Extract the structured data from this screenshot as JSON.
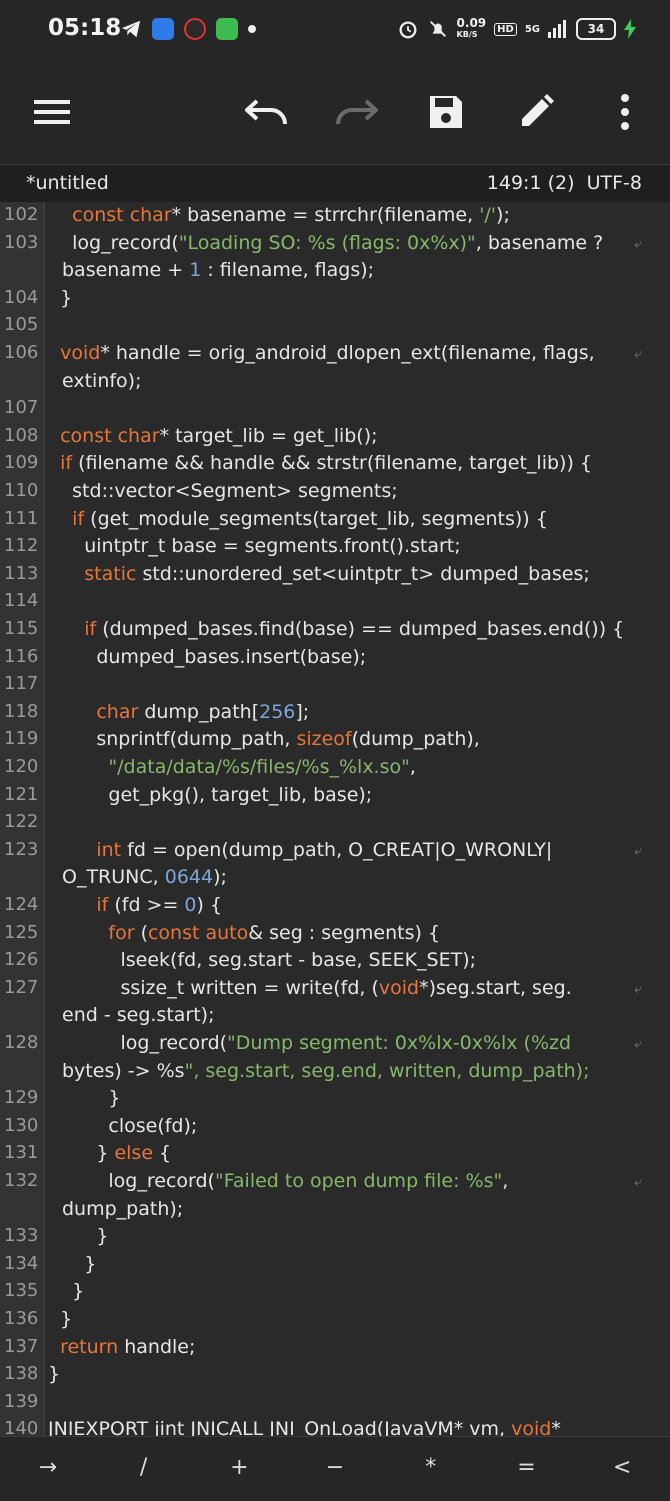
{
  "status_bar": {
    "time": "05:18",
    "net_speed": "0.09",
    "net_unit": "KB/S",
    "signal": "5G",
    "battery": "34"
  },
  "toolbar": {
    "menu_icon": "hamburger-menu-icon",
    "undo_icon": "undo-icon",
    "redo_icon": "redo-icon",
    "save_icon": "save-icon",
    "edit_icon": "pencil-icon",
    "more_icon": "more-vertical-icon"
  },
  "file": {
    "name": "*untitled",
    "position": "149:1 (2)",
    "encoding": "UTF-8"
  },
  "colors": {
    "keyword": "#e6763a",
    "string": "#86b86a",
    "number": "#7aa7d9",
    "text": "#e6e6e6",
    "background": "#2a2a2a",
    "gutter": "#333333"
  },
  "code_lines": [
    {
      "n": "102",
      "text": "    const char* basename = strrchr(filename, '/');"
    },
    {
      "n": "103",
      "text": "    log_record(\"Loading SO: %s (flags: 0x%x)\", basename ?",
      "wrap": "basename + 1 : filename, flags);"
    },
    {
      "n": "104",
      "text": "  }"
    },
    {
      "n": "105",
      "text": ""
    },
    {
      "n": "106",
      "text": "  void* handle = orig_android_dlopen_ext(filename, flags,",
      "wrap": "extinfo);"
    },
    {
      "n": "107",
      "text": ""
    },
    {
      "n": "108",
      "text": "  const char* target_lib = get_lib();"
    },
    {
      "n": "109",
      "text": "  if (filename && handle && strstr(filename, target_lib)) {"
    },
    {
      "n": "110",
      "text": "    std::vector<Segment> segments;"
    },
    {
      "n": "111",
      "text": "    if (get_module_segments(target_lib, segments)) {"
    },
    {
      "n": "112",
      "text": "      uintptr_t base = segments.front().start;"
    },
    {
      "n": "113",
      "text": "      static std::unordered_set<uintptr_t> dumped_bases;"
    },
    {
      "n": "114",
      "text": ""
    },
    {
      "n": "115",
      "text": "      if (dumped_bases.find(base) == dumped_bases.end()) {"
    },
    {
      "n": "116",
      "text": "        dumped_bases.insert(base);"
    },
    {
      "n": "117",
      "text": ""
    },
    {
      "n": "118",
      "text": "        char dump_path[256];"
    },
    {
      "n": "119",
      "text": "        snprintf(dump_path, sizeof(dump_path),"
    },
    {
      "n": "120",
      "text": "          \"/data/data/%s/files/%s_%lx.so\","
    },
    {
      "n": "121",
      "text": "          get_pkg(), target_lib, base);"
    },
    {
      "n": "122",
      "text": ""
    },
    {
      "n": "123",
      "text": "        int fd = open(dump_path, O_CREAT|O_WRONLY|",
      "wrap": "O_TRUNC, 0644);"
    },
    {
      "n": "124",
      "text": "        if (fd >= 0) {"
    },
    {
      "n": "125",
      "text": "          for (const auto& seg : segments) {"
    },
    {
      "n": "126",
      "text": "            lseek(fd, seg.start - base, SEEK_SET);"
    },
    {
      "n": "127",
      "text": "            ssize_t written = write(fd, (void*)seg.start, seg.",
      "wrap": "end - seg.start);"
    },
    {
      "n": "128",
      "text": "            log_record(\"Dump segment: 0x%lx-0x%lx (%zd",
      "wrap": "bytes) -> %s\", seg.start, seg.end, written, dump_path);"
    },
    {
      "n": "129",
      "text": "          }"
    },
    {
      "n": "130",
      "text": "          close(fd);"
    },
    {
      "n": "131",
      "text": "        } else {"
    },
    {
      "n": "132",
      "text": "          log_record(\"Failed to open dump file: %s\",",
      "wrap": "dump_path);"
    },
    {
      "n": "133",
      "text": "        }"
    },
    {
      "n": "134",
      "text": "      }"
    },
    {
      "n": "135",
      "text": "    }"
    },
    {
      "n": "136",
      "text": "  }"
    },
    {
      "n": "137",
      "text": "  return handle;"
    },
    {
      "n": "138",
      "text": "}"
    },
    {
      "n": "139",
      "text": ""
    },
    {
      "n": "140",
      "text": "JNIEXPORT jint JNICALL JNI_OnLoad(JavaVM* vm, void*"
    }
  ],
  "symbol_bar": [
    "→",
    "/",
    "+",
    "−",
    "*",
    "=",
    "<"
  ]
}
